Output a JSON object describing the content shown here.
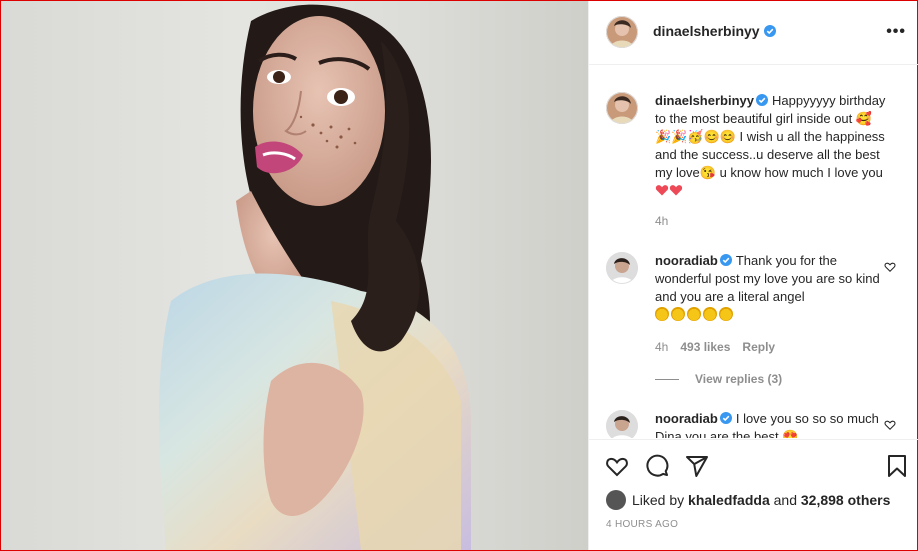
{
  "post": {
    "username": "dinaelsherbinyy",
    "more_label": "•••"
  },
  "caption": {
    "username": "dinaelsherbinyy",
    "text": "Happyyyyy birthday to the most beautiful girl inside out 🥰🎉🎉🥳😊😊 I wish u all the happiness and the success..u deserve all the best my love😘 u know how much I love you",
    "time": "4h"
  },
  "comments": [
    {
      "username": "nooradiab",
      "text": "Thank you for the wonderful post my love you are so kind and you are a literal angel",
      "emoji_count": 5,
      "time": "4h",
      "likes": "493 likes",
      "reply_label": "Reply",
      "view_replies": "View replies (3)"
    },
    {
      "username": "nooradiab",
      "text": "I love you so so so much Dina you are the best 😍"
    }
  ],
  "footer": {
    "liked_by_prefix": "Liked by",
    "liked_by_user": "khaledfadda",
    "liked_by_and": "and",
    "liked_by_count": "32,898 others",
    "timestamp": "4 HOURS AGO"
  },
  "icons": {
    "like": "heart-icon",
    "comment": "comment-icon",
    "share": "share-icon",
    "save": "bookmark-icon",
    "verified": "verified-badge-icon",
    "more": "more-options-icon"
  },
  "colors": {
    "verified": "#3897f0",
    "heart_red": "#ed4956",
    "muted": "#8e8e8e",
    "text": "#262626"
  }
}
